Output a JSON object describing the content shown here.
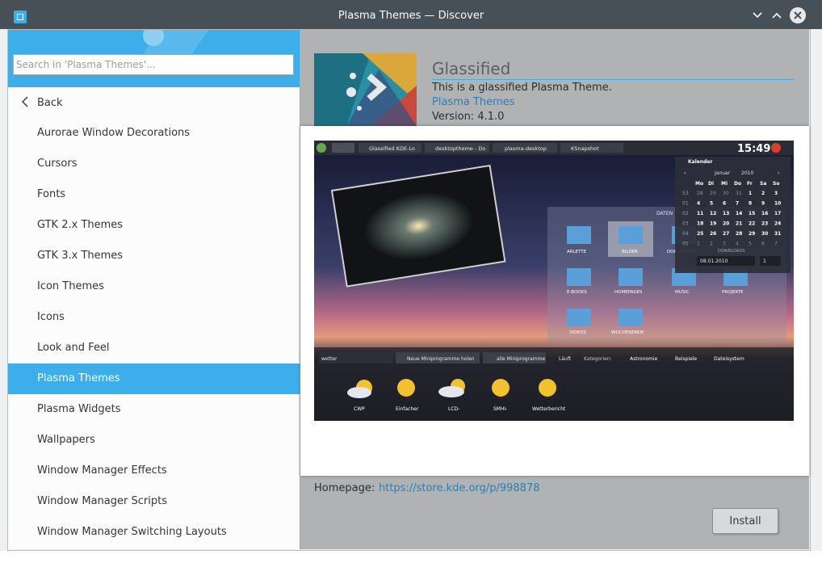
{
  "window": {
    "title": "Plasma Themes — Discover"
  },
  "search": {
    "placeholder": "Search in 'Plasma Themes'..."
  },
  "sidebar": {
    "back_label": "Back",
    "items": [
      {
        "label": "Aurorae Window Decorations"
      },
      {
        "label": "Cursors"
      },
      {
        "label": "Fonts"
      },
      {
        "label": "GTK 2.x Themes"
      },
      {
        "label": "GTK 3.x Themes"
      },
      {
        "label": "Icon Themes"
      },
      {
        "label": "Icons"
      },
      {
        "label": "Look and Feel"
      },
      {
        "label": "Plasma Themes",
        "active": true
      },
      {
        "label": "Plasma Widgets"
      },
      {
        "label": "Wallpapers"
      },
      {
        "label": "Window Manager Effects"
      },
      {
        "label": "Window Manager Scripts"
      },
      {
        "label": "Window Manager Switching Layouts"
      }
    ]
  },
  "app": {
    "name": "Glassified",
    "summary": "This is a glassified Plasma Theme.",
    "category": "Plasma Themes",
    "version": "Version: 4.1.0",
    "homepage_label": "Homepage:",
    "homepage_url": "https://store.kde.org/p/998878",
    "install_label": "Install"
  },
  "screenshot": {
    "tasks": [
      "Glassified KDE-Lo",
      "desktoptheme - Do",
      "plasma-desktop",
      "KSnapshot"
    ],
    "clock": "15:49",
    "calendar": {
      "title": "Kalender",
      "month": "Januar",
      "year": "2010",
      "weekdays": [
        "Mo",
        "Di",
        "Mi",
        "Do",
        "Fr",
        "Sa",
        "So"
      ],
      "weeks": [
        {
          "wk": "53",
          "days": [
            "28",
            "29",
            "30",
            "31",
            "1",
            "2",
            "3"
          ]
        },
        {
          "wk": "01",
          "days": [
            "4",
            "5",
            "6",
            "7",
            "8",
            "9",
            "10"
          ]
        },
        {
          "wk": "02",
          "days": [
            "11",
            "12",
            "13",
            "14",
            "15",
            "16",
            "17"
          ]
        },
        {
          "wk": "03",
          "days": [
            "18",
            "19",
            "20",
            "21",
            "22",
            "23",
            "24"
          ]
        },
        {
          "wk": "04",
          "days": [
            "25",
            "26",
            "27",
            "28",
            "29",
            "30",
            "31"
          ]
        },
        {
          "wk": "05",
          "days": [
            "1",
            "2",
            "3",
            "4",
            "5",
            "6",
            "7"
          ]
        }
      ],
      "date_field": "08.01.2010",
      "week_field": "1"
    },
    "folder_view_title": "DATEN",
    "folders": [
      "ARLETTE",
      "BILDER",
      "DOKUMENTE",
      "E-BOOKS",
      "HOMEPAGES",
      "MUSIC",
      "PROJEKTE",
      "VIDEOS",
      "WOCHENENDE"
    ],
    "downloads_label": "DOWNLOADS",
    "widget_bar": {
      "search_text": "wetter",
      "new_widgets": "Neue Miniprogramme holen",
      "all_widgets": "alle Miniprogramme",
      "running": "Läuft",
      "categories_label": "Kategorien:",
      "categories": [
        "Astronomie",
        "Beispiele",
        "Dateisystem"
      ]
    },
    "widgets": [
      "CWP",
      "Einfacher",
      "LCD-",
      "SMHI-",
      "Wetterbericht"
    ]
  }
}
